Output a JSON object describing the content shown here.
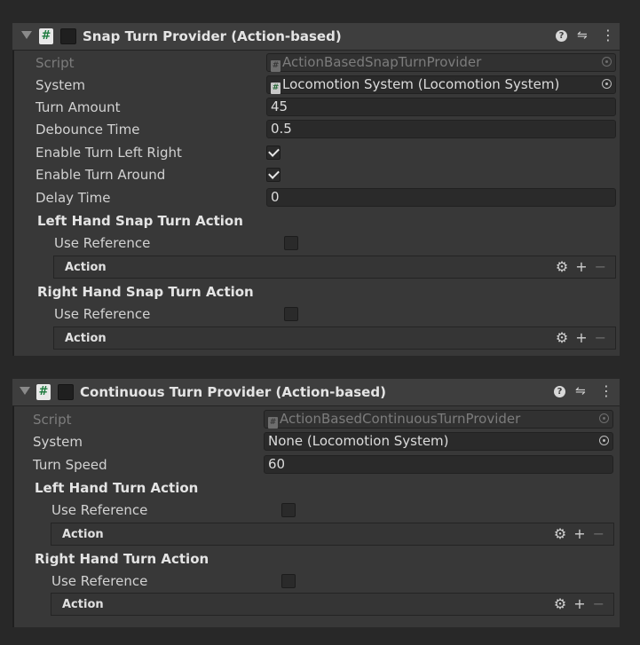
{
  "snap": {
    "title": "Snap Turn Provider (Action-based)",
    "icons": [
      "help-icon",
      "presets-icon",
      "more-icon"
    ],
    "script_label": "Script",
    "script_value": "ActionBasedSnapTurnProvider",
    "system_label": "System",
    "system_value": "Locomotion System (Locomotion System)",
    "turn_amount_label": "Turn Amount",
    "turn_amount_value": "45",
    "debounce_label": "Debounce Time",
    "debounce_value": "0.5",
    "enable_lr_label": "Enable Turn Left Right",
    "enable_lr_checked": true,
    "enable_around_label": "Enable Turn Around",
    "enable_around_checked": true,
    "delay_label": "Delay Time",
    "delay_value": "0",
    "left_action_title": "Left Hand Snap Turn Action",
    "left_use_ref_label": "Use Reference",
    "left_action_label": "Action",
    "right_action_title": "Right Hand Snap Turn Action",
    "right_use_ref_label": "Use Reference",
    "right_action_label": "Action"
  },
  "continuous": {
    "title": "Continuous Turn Provider (Action-based)",
    "icons": [
      "help-icon",
      "presets-icon",
      "more-icon"
    ],
    "script_label": "Script",
    "script_value": "ActionBasedContinuousTurnProvider",
    "system_label": "System",
    "system_value": "None (Locomotion System)",
    "turn_speed_label": "Turn Speed",
    "turn_speed_value": "60",
    "left_action_title": "Left Hand Turn Action",
    "left_use_ref_label": "Use Reference",
    "left_action_label": "Action",
    "right_action_title": "Right Hand Turn Action",
    "right_use_ref_label": "Use Reference",
    "right_action_label": "Action"
  },
  "glyphs": {
    "script_hash": "#",
    "gear": "⚙",
    "plus": "+",
    "minus": "−",
    "more": "⋮",
    "presets": "⇋",
    "help": "?"
  }
}
